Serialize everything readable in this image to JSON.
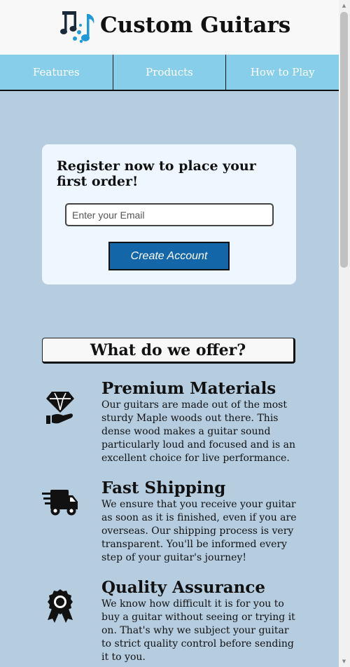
{
  "header": {
    "title": "Custom Guitars",
    "logo_icon": "music-notes-icon"
  },
  "nav": {
    "items": [
      {
        "label": "Features"
      },
      {
        "label": "Products"
      },
      {
        "label": "How to Play"
      }
    ]
  },
  "register": {
    "heading": "Register now to place your first order!",
    "email_placeholder": "Enter your Email",
    "email_value": "",
    "button_label": "Create Account"
  },
  "offer": {
    "title": "What do we offer?"
  },
  "features": [
    {
      "icon": "diamond-hand-icon",
      "title": "Premium Materials",
      "text": "Our guitars are made out of the most sturdy Maple woods out there. This dense wood makes a guitar sound particularly loud and focused and is an excellent choice for live performance."
    },
    {
      "icon": "shipping-truck-icon",
      "title": "Fast Shipping",
      "text": "We ensure that you receive your guitar as soon as it is finished, even if you are overseas. Our shipping process is very transparent. You'll be informed every step of your guitar's journey!"
    },
    {
      "icon": "award-ribbon-icon",
      "title": "Quality Assurance",
      "text": "We know how difficult it is for you to buy a guitar without seeing or trying it on. That's why we subject your guitar to strict quality control before sending it to you."
    }
  ],
  "colors": {
    "page_background": "#b6cde0",
    "nav_background": "#87ceeb",
    "button_background": "#1366a8",
    "card_background": "#eef7ff",
    "logo_accent": "#1f9ad6",
    "logo_dark": "#1a2a3a"
  }
}
